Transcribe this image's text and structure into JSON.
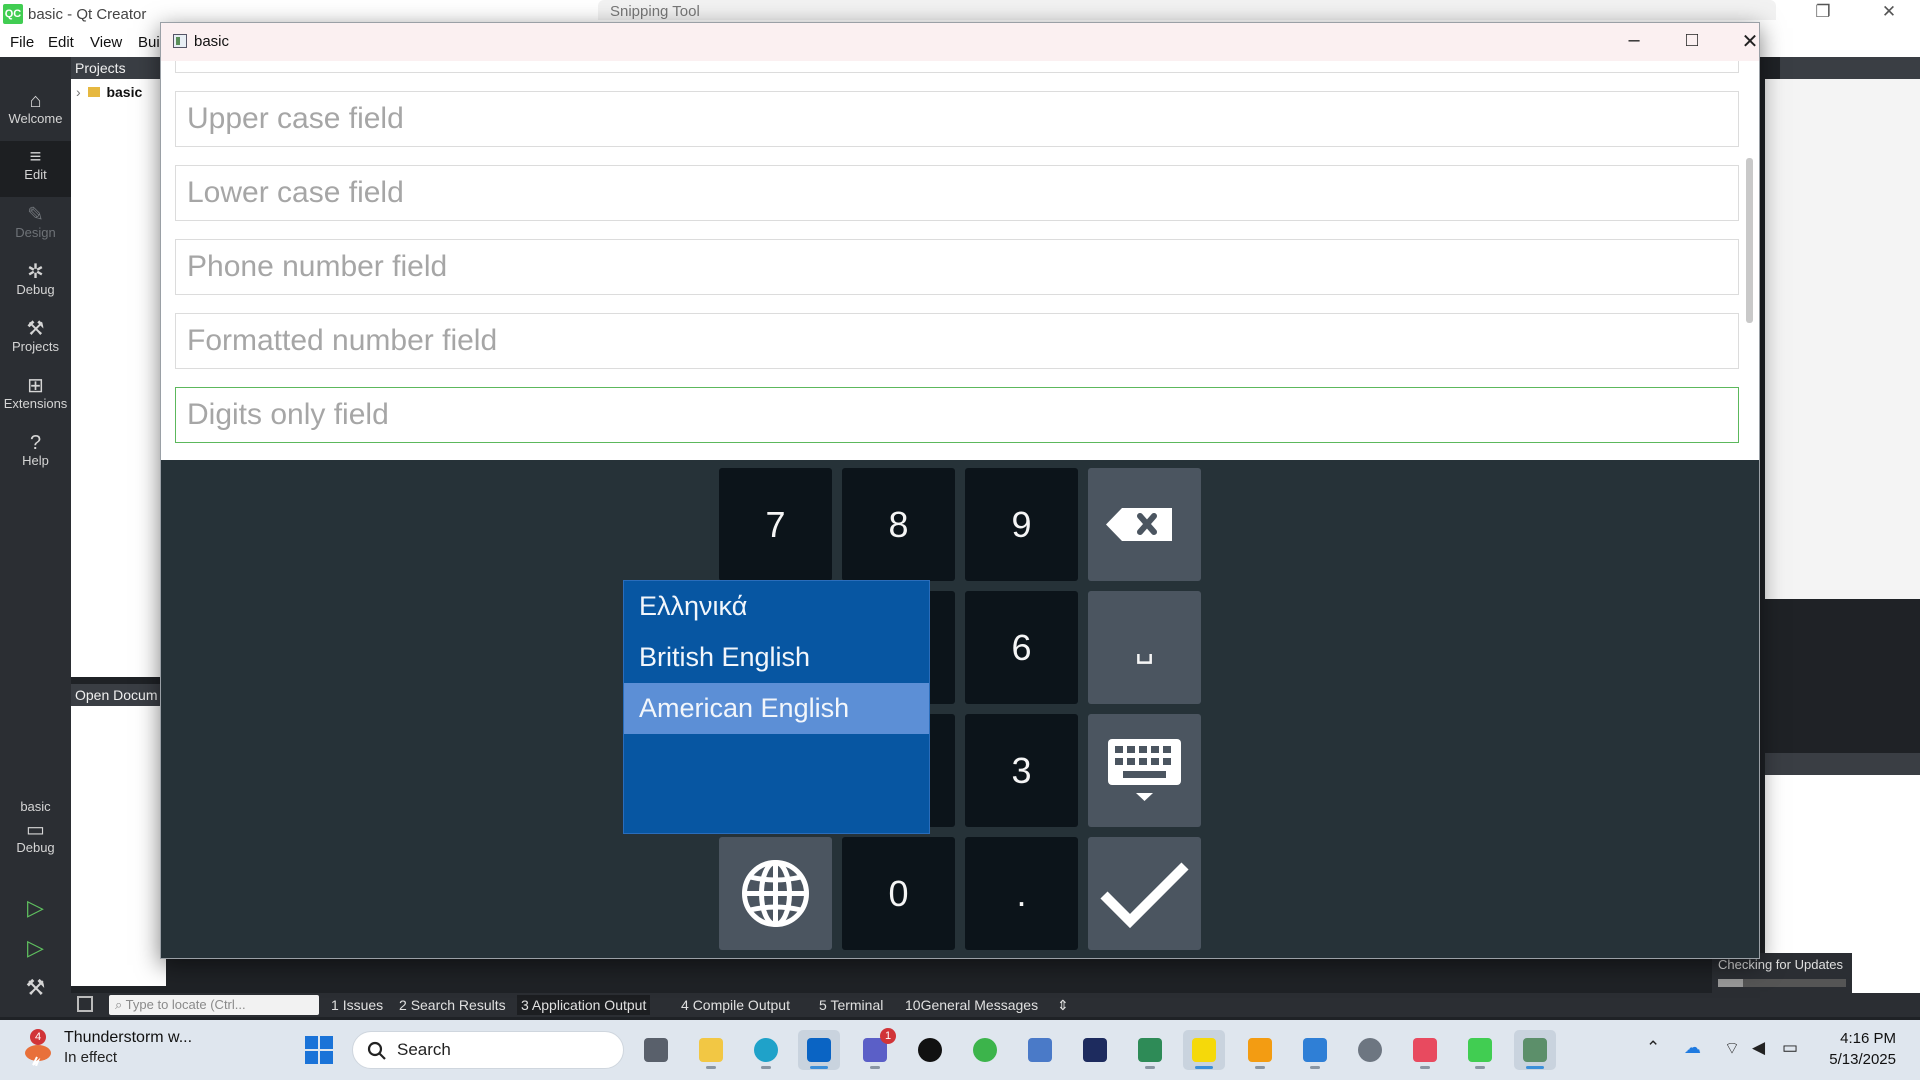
{
  "qt": {
    "title": "basic - Qt Creator",
    "logo": "QC",
    "menu": [
      "File",
      "Edit",
      "View",
      "Bui"
    ],
    "modes": [
      {
        "label": "Welcome",
        "icon": "home-icon"
      },
      {
        "label": "Edit",
        "icon": "edit-icon"
      },
      {
        "label": "Design",
        "icon": "design-icon"
      },
      {
        "label": "Debug",
        "icon": "debug-icon"
      },
      {
        "label": "Projects",
        "icon": "wrench-icon"
      },
      {
        "label": "Extensions",
        "icon": "extensions-icon"
      },
      {
        "label": "Help",
        "icon": "help-icon"
      }
    ],
    "target": {
      "project": "basic",
      "config": "Debug"
    },
    "projects_header": "Projects",
    "project_tree_item": "basic",
    "open_documents_header": "Open Docum",
    "locate_placeholder": "Type to locate (Ctrl...",
    "output_tabs": [
      {
        "num": "1",
        "label": "Issues"
      },
      {
        "num": "2",
        "label": "Search Results"
      },
      {
        "num": "3",
        "label": "Application Output"
      },
      {
        "num": "4",
        "label": "Compile Output"
      },
      {
        "num": "5",
        "label": "Terminal"
      },
      {
        "num": "10",
        "label": "General Messages"
      }
    ],
    "updates_text": "Checking for Updates"
  },
  "snipping_tool": {
    "title": "Snipping Tool"
  },
  "app": {
    "title": "basic",
    "fields": [
      {
        "placeholder": "Upper case field",
        "focused": false
      },
      {
        "placeholder": "Lower case field",
        "focused": false
      },
      {
        "placeholder": "Phone number field",
        "focused": false
      },
      {
        "placeholder": "Formatted number field",
        "focused": false
      },
      {
        "placeholder": "Digits only field",
        "focused": true
      }
    ],
    "keyboard": {
      "keys": {
        "k7": "7",
        "k8": "8",
        "k9": "9",
        "k6": "6",
        "k3": "3",
        "k0": "0",
        "dot": "."
      },
      "space_label": "␣",
      "languages": [
        {
          "label": "Ελληνικά",
          "selected": false
        },
        {
          "label": "British English",
          "selected": false
        },
        {
          "label": "American English",
          "selected": true
        }
      ]
    }
  },
  "taskbar": {
    "weather": {
      "badge": "4",
      "title": "Thunderstorm w...",
      "subtitle": "In effect"
    },
    "search_placeholder": "Search",
    "teams_badge": "1",
    "clock": {
      "time": "4:16 PM",
      "date": "5/13/2025"
    },
    "colors": {
      "accent": "#3b8fd9",
      "keyboard_bg": "#263238",
      "lang_popup": "#0756a2",
      "lang_selected": "#5c8fd6",
      "focus_border": "#5cb85c"
    }
  }
}
